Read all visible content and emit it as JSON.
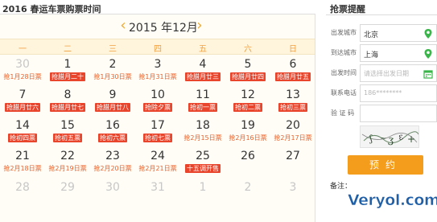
{
  "header": {
    "title": "2016 春运车票购票时间"
  },
  "calendar": {
    "month_title": "2015 年12月",
    "prev_icon": "chevron-left-icon",
    "next_icon": "chevron-right-icon",
    "weekdays": [
      "一",
      "二",
      "三",
      "四",
      "五",
      "六",
      "日"
    ],
    "accent_color": "#f0a040",
    "tag_color": "#e8452c",
    "weeks": [
      [
        {
          "num": "30",
          "tag": "抢1月28日票",
          "dim": true,
          "red": false
        },
        {
          "num": "1",
          "tag": "抢腊月二十",
          "dim": false,
          "red": true
        },
        {
          "num": "2",
          "tag": "抢1月30日票",
          "dim": false,
          "red": false
        },
        {
          "num": "3",
          "tag": "抢1月31日票",
          "dim": false,
          "red": false
        },
        {
          "num": "4",
          "tag": "抢腊月廿三",
          "dim": false,
          "red": true
        },
        {
          "num": "5",
          "tag": "抢腊月廿四",
          "dim": false,
          "red": true
        },
        {
          "num": "6",
          "tag": "抢腊月廿五",
          "dim": false,
          "red": true
        }
      ],
      [
        {
          "num": "7",
          "tag": "抢腊月廿六",
          "dim": false,
          "red": true
        },
        {
          "num": "8",
          "tag": "抢腊月廿七",
          "dim": false,
          "red": true
        },
        {
          "num": "9",
          "tag": "抢腊月廿八",
          "dim": false,
          "red": true
        },
        {
          "num": "10",
          "tag": "抢除夕票",
          "dim": false,
          "red": true
        },
        {
          "num": "11",
          "tag": "抢初一票",
          "dim": false,
          "red": true
        },
        {
          "num": "12",
          "tag": "抢初二票",
          "dim": false,
          "red": true
        },
        {
          "num": "13",
          "tag": "抢初三票",
          "dim": false,
          "red": true
        }
      ],
      [
        {
          "num": "14",
          "tag": "抢初四票",
          "dim": false,
          "red": true
        },
        {
          "num": "15",
          "tag": "抢初五票",
          "dim": false,
          "red": true
        },
        {
          "num": "16",
          "tag": "抢初六票",
          "dim": false,
          "red": true
        },
        {
          "num": "17",
          "tag": "抢初七票",
          "dim": false,
          "red": true
        },
        {
          "num": "18",
          "tag": "抢2月15日票",
          "dim": false,
          "red": false
        },
        {
          "num": "19",
          "tag": "抢2月16日票",
          "dim": false,
          "red": false
        },
        {
          "num": "20",
          "tag": "抢2月17日票",
          "dim": false,
          "red": false
        }
      ],
      [
        {
          "num": "21",
          "tag": "抢2月18日票",
          "dim": false,
          "red": false
        },
        {
          "num": "22",
          "tag": "抢2月19日票",
          "dim": false,
          "red": false
        },
        {
          "num": "23",
          "tag": "抢2月20日票",
          "dim": false,
          "red": false
        },
        {
          "num": "24",
          "tag": "抢2月21日票",
          "dim": false,
          "red": false
        },
        {
          "num": "25",
          "tag": "十五调开售",
          "dim": false,
          "red": true
        },
        {
          "num": "26",
          "tag": "",
          "dim": false,
          "red": false
        },
        {
          "num": "27",
          "tag": "",
          "dim": false,
          "red": false
        }
      ],
      [
        {
          "num": "28",
          "tag": "",
          "dim": true,
          "red": false
        },
        {
          "num": "29",
          "tag": "",
          "dim": true,
          "red": false
        },
        {
          "num": "30",
          "tag": "",
          "dim": true,
          "red": false
        },
        {
          "num": "31",
          "tag": "",
          "dim": true,
          "red": false
        },
        {
          "num": "1",
          "tag": "",
          "dim": true,
          "red": false
        },
        {
          "num": "2",
          "tag": "",
          "dim": true,
          "red": false
        },
        {
          "num": "3",
          "tag": "",
          "dim": true,
          "red": false
        }
      ]
    ]
  },
  "sidebar": {
    "title": "抢票提醒",
    "from_label": "出发城市",
    "from_value": "北京",
    "from_icon": "map-pin-icon",
    "to_label": "到达城市",
    "to_value": "上海",
    "to_icon": "map-pin-icon",
    "date_label": "出发时间",
    "date_placeholder": "请选择出发日期",
    "date_icon": "calendar-icon",
    "phone_label": "联系电话",
    "phone_value": "186********",
    "captcha_label": "验 证 码",
    "submit_label": "预约",
    "submit_color": "#f49c1c",
    "notes_title": "备注："
  },
  "watermark": {
    "text": "Veryol.com"
  }
}
